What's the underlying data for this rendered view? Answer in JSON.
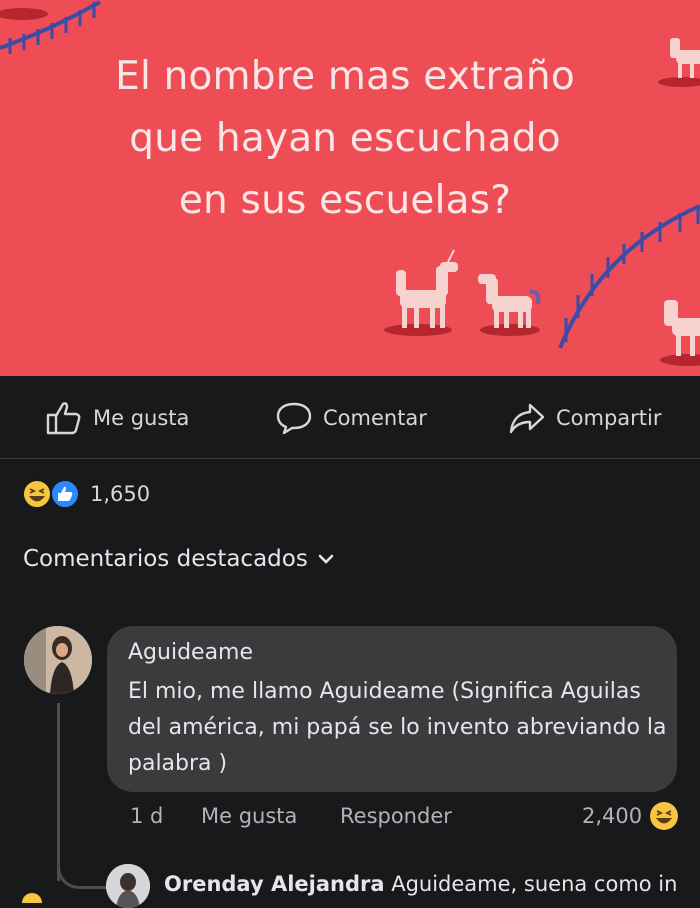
{
  "banner": {
    "background": "#ee4d55",
    "question_lines": [
      "El nombre mas extraño",
      "que hayan escuchado",
      "en sus escuelas?"
    ]
  },
  "actions": {
    "like": {
      "label": "Me gusta",
      "icon": "thumbs-up-icon"
    },
    "comment": {
      "label": "Comentar",
      "icon": "speech-bubble-icon"
    },
    "share": {
      "label": "Compartir",
      "icon": "share-arrow-icon"
    }
  },
  "reactions": {
    "icons": [
      "laugh-emoji-icon",
      "like-badge-icon"
    ],
    "count": "1,650"
  },
  "comments_sort": {
    "label": "Comentarios destacados",
    "icon": "chevron-down-icon"
  },
  "comment": {
    "author": "Aguideame",
    "text": "El mio, me llamo Aguideame (Significa Aguilas del américa, mi papá se lo invento abreviando la palabra )",
    "time": "1 d",
    "like_label": "Me gusta",
    "reply_label": "Responder",
    "reaction_count": "2,400",
    "reaction_icon": "laugh-emoji-icon"
  },
  "reply_preview": {
    "author": "Orenday Alejandra",
    "text": "Aguideame, suena como in"
  }
}
